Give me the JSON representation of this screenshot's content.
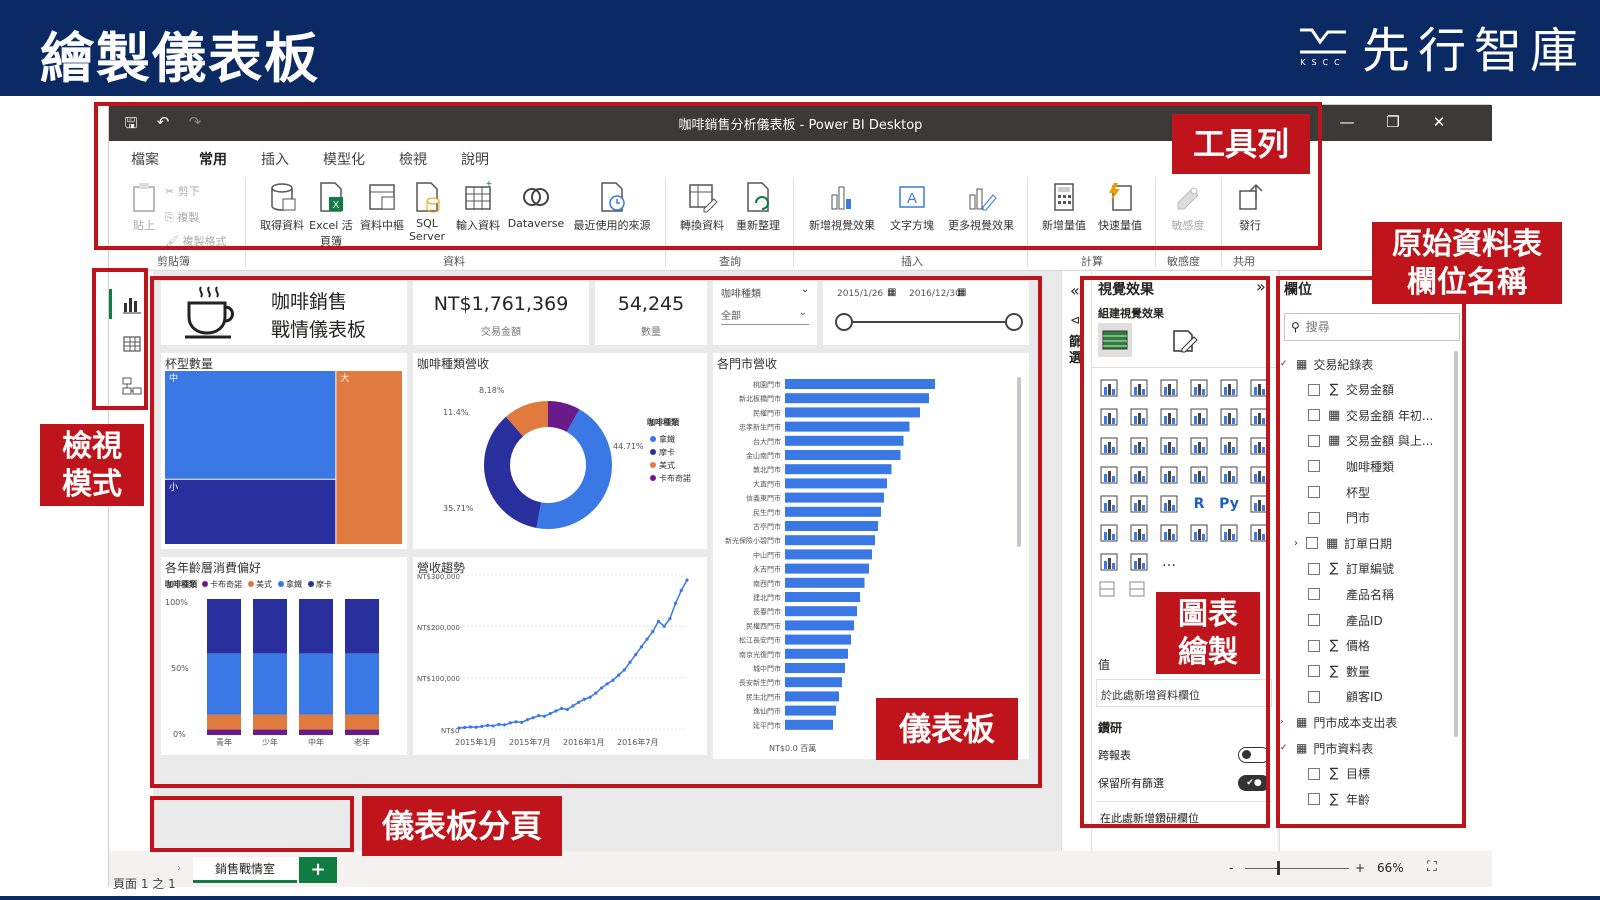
{
  "banner": {
    "title": "繪製儀表板",
    "brand_mark": "KSCC",
    "brand_name": "先行智庫"
  },
  "window": {
    "title": "咖啡銷售分析儀表板 - Power BI Desktop",
    "menu": [
      "檔案",
      "常用",
      "插入",
      "模型化",
      "檢視",
      "說明"
    ],
    "active_menu": "常用"
  },
  "ribbon": {
    "clipboard": {
      "paste": "貼上",
      "cut": "剪下",
      "copy": "複製",
      "format_painter": "複製格式",
      "group": "剪貼簿"
    },
    "data": {
      "buttons": [
        "取得資料",
        "Excel 活頁簿",
        "資料中樞",
        "SQL Server",
        "輸入資料",
        "Dataverse",
        "最近使用的來源"
      ],
      "group": "資料"
    },
    "query": {
      "buttons": [
        "轉換資料",
        "重新整理"
      ],
      "group": "查詢"
    },
    "insert": {
      "buttons": [
        "新增視覺效果",
        "文字方塊",
        "更多視覺效果"
      ],
      "group": "插入"
    },
    "calc": {
      "buttons": [
        "新增量值",
        "快速量值"
      ],
      "group": "計算"
    },
    "sensitivity": {
      "buttons": [
        "敏感度"
      ],
      "group": "敏感度"
    },
    "share": {
      "buttons": [
        "發行"
      ],
      "group": "共用"
    }
  },
  "dashboard": {
    "title_line1": "咖啡銷售",
    "title_line2": "戰情儀表板",
    "kpi_amount": "NT$1,761,369",
    "kpi_amount_label": "交易金額",
    "kpi_qty": "54,245",
    "kpi_qty_label": "數量",
    "slicer_label": "咖啡種類",
    "slicer_value": "全部",
    "date_from": "2015/1/26",
    "date_to": "2016/12/30",
    "cup_chart_title": "杯型數量",
    "cup_labels": [
      "中",
      "大",
      "小"
    ],
    "donut_title": "咖啡種類營收",
    "donut_legend_title": "咖啡種類",
    "donut_labels": [
      "8.18%",
      "11.4%",
      "44.71%",
      "35.71%"
    ],
    "age_title": "各年齡層消費偏好",
    "age_legend_title": "咖啡種類",
    "age_axis": [
      "100%",
      "50%",
      "0%"
    ],
    "trend_title": "營收趨勢",
    "trend_y": [
      "NT$300,000",
      "NT$200,000",
      "NT$100,000",
      "NT$0"
    ],
    "trend_x": [
      "2015年1月",
      "2015年7月",
      "2016年1月",
      "2016年7月"
    ],
    "store_title": "各門市營收",
    "store_axis": "NT$0.0 百萬"
  },
  "chart_data": [
    {
      "type": "area",
      "title": "杯型數量",
      "categories": [
        "中",
        "大",
        "小"
      ],
      "values": [
        45,
        28,
        27
      ]
    },
    {
      "type": "pie",
      "title": "咖啡種類營收",
      "legend_title": "咖啡種類",
      "categories": [
        "拿鐵",
        "摩卡",
        "美式",
        "卡布奇諾"
      ],
      "values": [
        44.71,
        35.71,
        11.4,
        8.18
      ],
      "colors": [
        "#3a78e6",
        "#2a2f9e",
        "#e07a3f",
        "#6a1b8a"
      ],
      "legend": "right"
    },
    {
      "type": "bar",
      "title": "各年齡層消費偏好",
      "legend_title": "咖啡種類",
      "categories": [
        "青年",
        "少年",
        "中年",
        "老年"
      ],
      "series": [
        {
          "name": "卡布奇諾",
          "values": [
            4,
            4,
            4,
            4
          ]
        },
        {
          "name": "美式",
          "values": [
            11,
            11,
            11,
            11
          ]
        },
        {
          "name": "拿鐵",
          "values": [
            45,
            45,
            45,
            45
          ]
        },
        {
          "name": "摩卡",
          "values": [
            40,
            40,
            40,
            40
          ]
        }
      ],
      "ylim": [
        0,
        100
      ],
      "stacked": true
    },
    {
      "type": "line",
      "title": "營收趨勢",
      "x_ticks": [
        "2015年1月",
        "2015年7月",
        "2016年1月",
        "2016年7月"
      ],
      "values": [
        2000,
        3000,
        4000,
        3500,
        5000,
        7000,
        6000,
        9000,
        8000,
        12000,
        14000,
        13000,
        18000,
        22000,
        26000,
        25000,
        30000,
        35000,
        40000,
        38000,
        45000,
        52000,
        58000,
        62000,
        70000,
        80000,
        88000,
        95000,
        105000,
        115000,
        130000,
        145000,
        160000,
        175000,
        190000,
        210000,
        200000,
        215000,
        245000,
        270000,
        290000
      ],
      "ylim": [
        0,
        300000
      ]
    },
    {
      "type": "bar",
      "orientation": "horizontal",
      "title": "各門市營收",
      "categories": [
        "桃園門市",
        "新北板橋門市",
        "民權門市",
        "忠孝新生門市",
        "台大門市",
        "金山南門市",
        "敦北門市",
        "大直門市",
        "信義東門市",
        "民生門市",
        "古亭門市",
        "新光保險小碧門市",
        "中山門市",
        "永吉門市",
        "南西門市",
        "建北門市",
        "長春門市",
        "民權西門市",
        "松江長安門市",
        "南京光復門市",
        "城中門市",
        "長安新生門市",
        "民生北門市",
        "逸仙門市",
        "延平門市"
      ],
      "values": [
        100,
        96,
        90,
        83,
        79,
        77,
        71,
        68,
        66,
        64,
        62,
        60,
        58,
        56,
        53,
        50,
        48,
        46,
        44,
        42,
        40,
        38,
        36,
        34,
        32
      ]
    }
  ],
  "filters_label": "篩選",
  "viz_pane": {
    "title": "視覺效果",
    "subtitle": "組建視覺效果",
    "values_label": "值",
    "values_placeholder": "於此處新增資料欄位",
    "drill_label": "鑽研",
    "cross_report": "跨報表",
    "keep_filters": "保留所有篩選",
    "drill_placeholder": "在此處新增鑽研欄位",
    "r_label": "R",
    "py_label": "Py",
    "more": "…"
  },
  "fields_pane": {
    "title": "欄位",
    "search_placeholder": "搜尋",
    "tables": [
      {
        "name": "交易紀錄表",
        "fields": [
          {
            "sig": "∑",
            "name": "交易金額"
          },
          {
            "sig": "▦",
            "name": "交易金額 年初..."
          },
          {
            "sig": "▦",
            "name": "交易金額 與上..."
          },
          {
            "sig": "",
            "name": "咖啡種類"
          },
          {
            "sig": "",
            "name": "杯型"
          },
          {
            "sig": "",
            "name": "門市"
          },
          {
            "sig": "▦",
            "name": "訂單日期"
          },
          {
            "sig": "∑",
            "name": "訂單編號"
          },
          {
            "sig": "",
            "name": "產品名稱"
          },
          {
            "sig": "",
            "name": "產品ID"
          },
          {
            "sig": "∑",
            "name": "價格"
          },
          {
            "sig": "∑",
            "name": "數量"
          },
          {
            "sig": "",
            "name": "顧客ID"
          }
        ]
      },
      {
        "name": "門市成本支出表",
        "fields": []
      },
      {
        "name": "門市資料表",
        "fields": [
          {
            "sig": "∑",
            "name": "目標"
          },
          {
            "sig": "∑",
            "name": "年齡"
          }
        ]
      }
    ]
  },
  "page_tab": "銷售戰情室",
  "page_add": "+",
  "status": {
    "page": "頁面 1 之 1",
    "zoom": "66%",
    "zoom_minus": "-",
    "zoom_plus": "+"
  },
  "annotations": {
    "toolbar": "工具列",
    "view_mode_1": "檢視",
    "view_mode_2": "模式",
    "source_fields_1": "原始資料表",
    "source_fields_2": "欄位名稱",
    "chart_draw_1": "圖表",
    "chart_draw_2": "繪製",
    "dashboard": "儀表板",
    "dashboard_pages": "儀表板分頁"
  }
}
